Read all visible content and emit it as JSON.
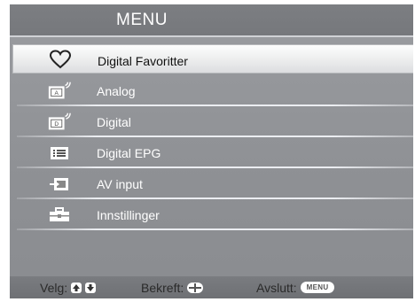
{
  "menu": {
    "title": "MENU",
    "items": [
      {
        "label": "Digital Favoritter",
        "icon": "heart-icon",
        "selected": true
      },
      {
        "label": "Analog",
        "icon": "analog-tv-icon",
        "selected": false
      },
      {
        "label": "Digital",
        "icon": "digital-tv-icon",
        "selected": false
      },
      {
        "label": "Digital EPG",
        "icon": "epg-list-icon",
        "selected": false
      },
      {
        "label": "AV input",
        "icon": "av-input-icon",
        "selected": false
      },
      {
        "label": "Innstillinger",
        "icon": "toolbox-icon",
        "selected": false
      }
    ]
  },
  "footer": {
    "select_label": "Velg:",
    "confirm_label": "Bekreft:",
    "exit_label": "Avslutt:",
    "exit_key": "MENU"
  },
  "colors": {
    "panel": "#8e9094",
    "header": "#76787c",
    "selected_bg": "#eceded",
    "text": "#ffffff"
  }
}
